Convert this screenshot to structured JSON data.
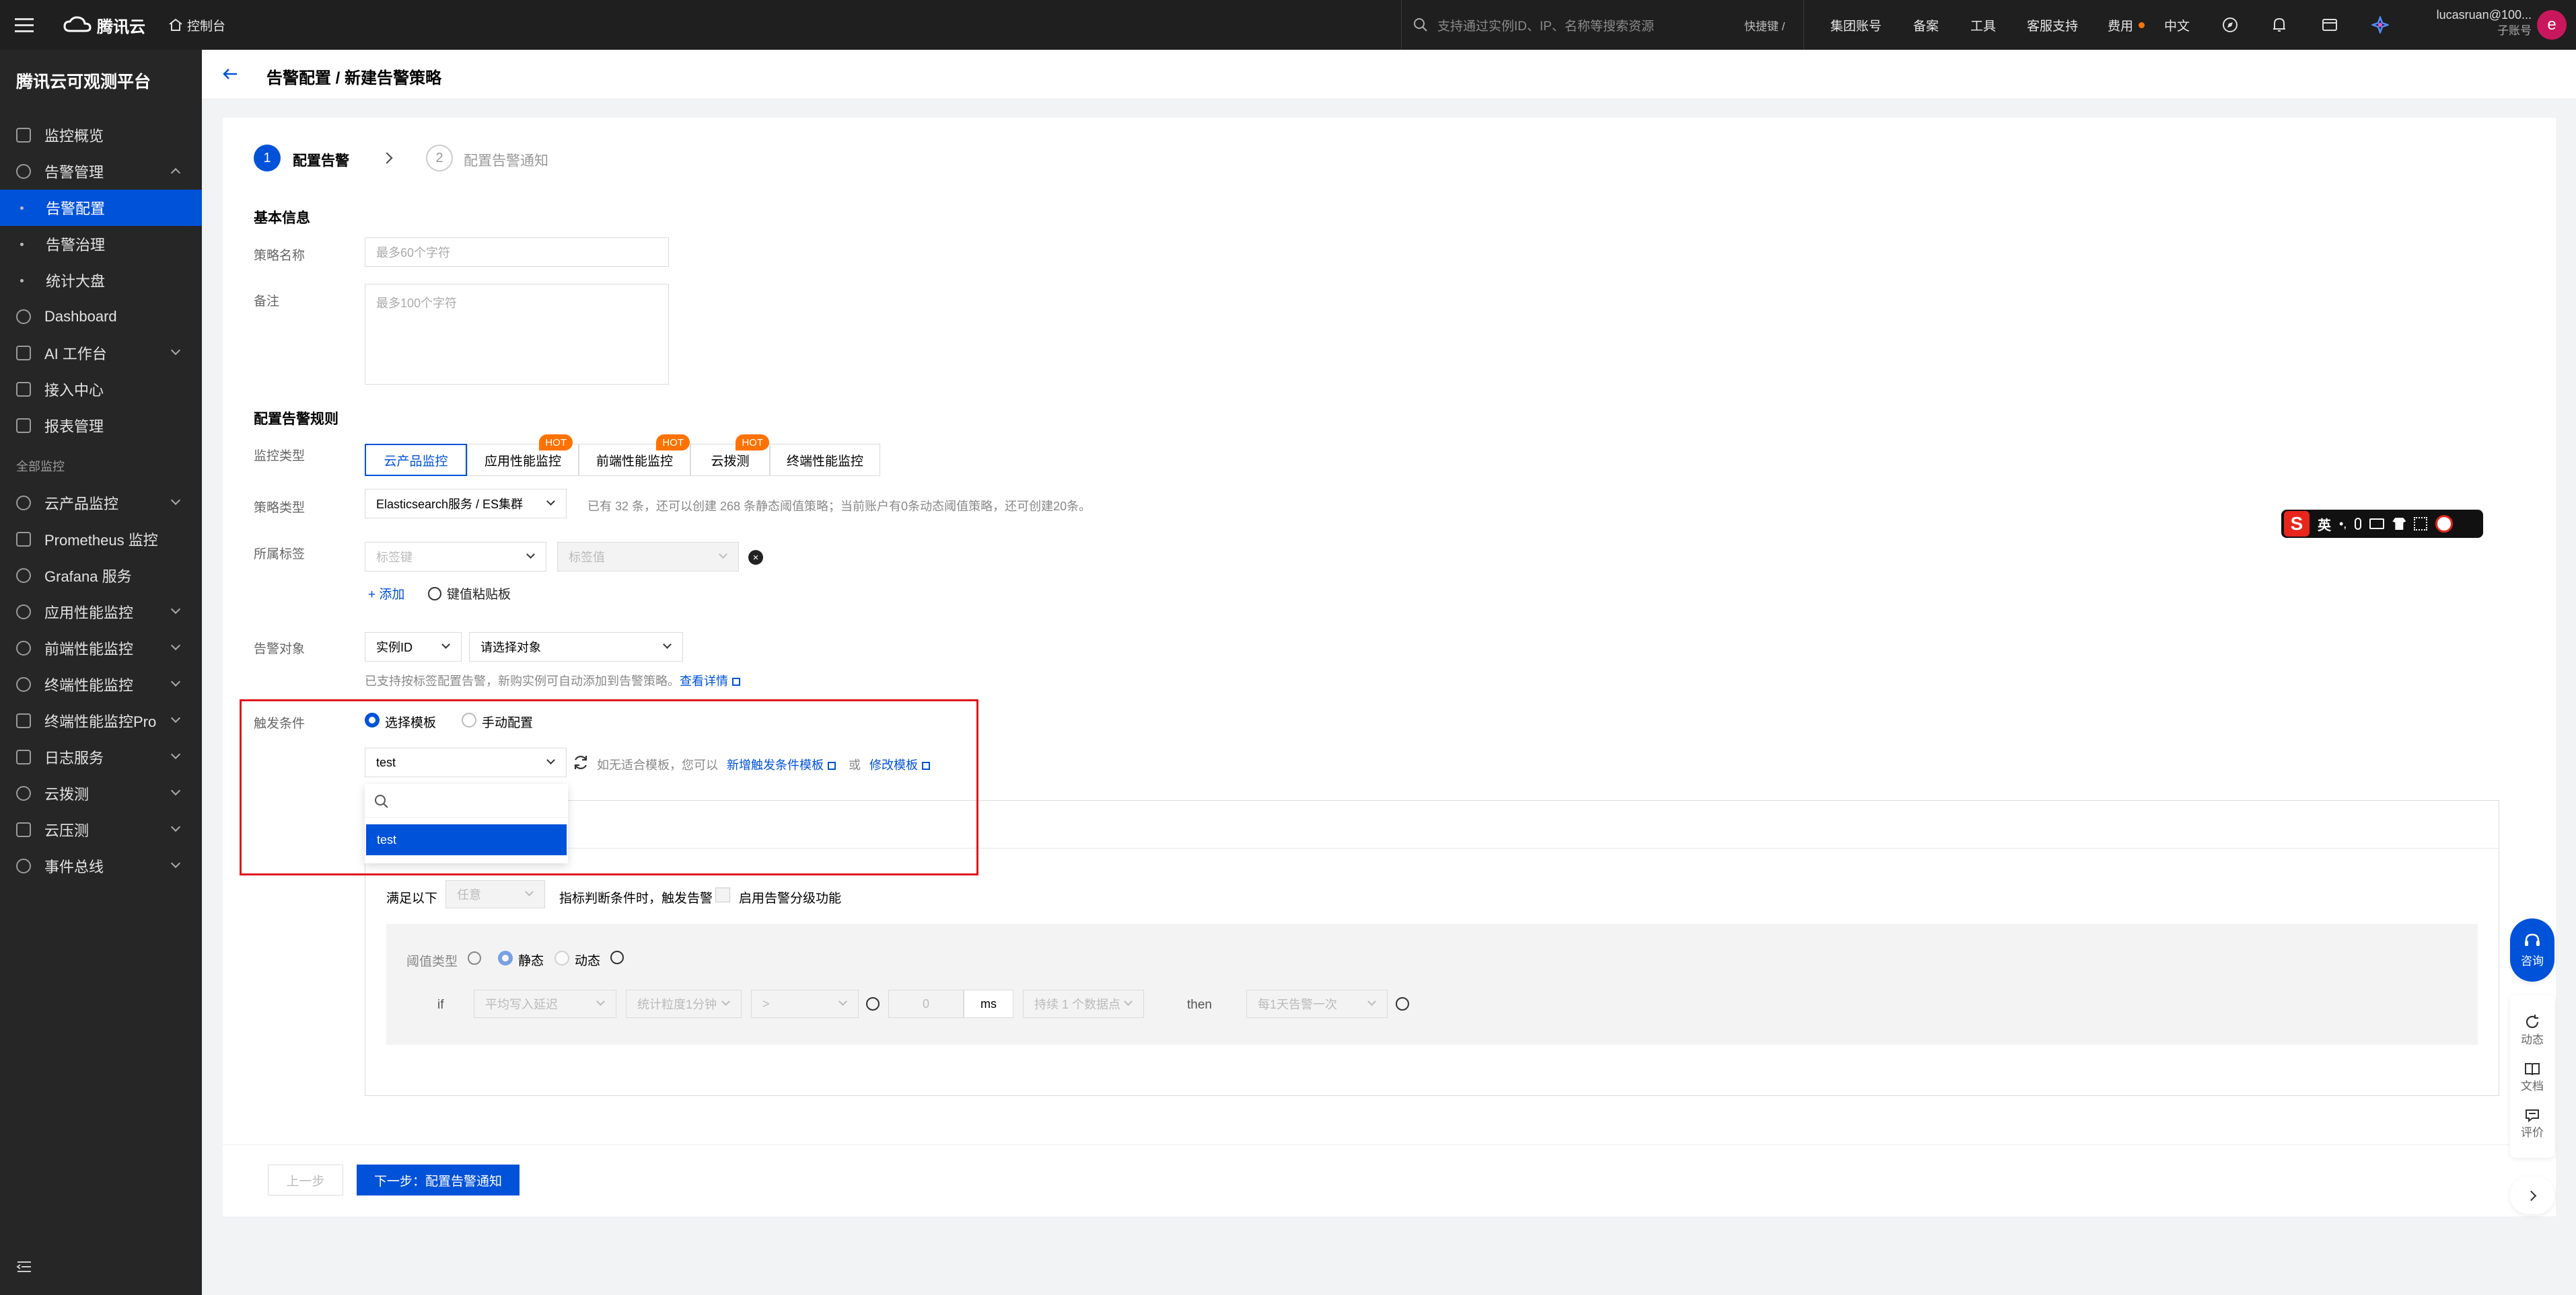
{
  "topbar": {
    "brand": "腾讯云",
    "console": "控制台",
    "search_placeholder": "支持通过实例ID、IP、名称等搜索资源",
    "shortcut": "快捷键 /",
    "links": [
      "集团账号",
      "备案",
      "工具",
      "客服支持",
      "费用",
      "中文"
    ],
    "user_name": "lucasruan@100...",
    "user_role": "子账号",
    "avatar_letter": "e"
  },
  "sidebar": {
    "title": "腾讯云可观测平台",
    "section_label": "全部监控",
    "items": [
      "监控概览",
      "告警管理",
      "告警配置",
      "告警治理",
      "统计大盘",
      "Dashboard",
      "AI 工作台",
      "接入中心",
      "报表管理",
      "云产品监控",
      "Prometheus 监控",
      "Grafana 服务",
      "应用性能监控",
      "前端性能监控",
      "终端性能监控",
      "终端性能监控Pro",
      "日志服务",
      "云拨测",
      "云压测",
      "事件总线"
    ]
  },
  "header": {
    "title": "告警配置 / 新建告警策略"
  },
  "steps": [
    {
      "num": "1",
      "label": "配置告警"
    },
    {
      "num": "2",
      "label": "配置告警通知"
    }
  ],
  "basic": {
    "section": "基本信息",
    "name_label": "策略名称",
    "name_placeholder": "最多60个字符",
    "remark_label": "备注",
    "remark_placeholder": "最多100个字符"
  },
  "rules": {
    "section": "配置告警规则",
    "monitor_type_label": "监控类型",
    "monitor_types": [
      "云产品监控",
      "应用性能监控",
      "前端性能监控",
      "云拨测",
      "终端性能监控"
    ],
    "hot_badge": "HOT",
    "policy_type_label": "策略类型",
    "policy_type_value": "Elasticsearch服务 / ES集群",
    "policy_note": "已有 32 条，还可以创建 268 条静态阈值策略；当前账户有0条动态阈值策略，还可创建20条。",
    "tag_label": "所属标签",
    "tag_key_placeholder": "标签键",
    "tag_value_placeholder": "标签值",
    "add_label": "添加",
    "paste_label": "键值粘贴板",
    "target_label": "告警对象",
    "target_type": "实例ID",
    "target_placeholder": "请选择对象",
    "target_note": "已支持按标签配置告警，新购实例可自动添加到告警策略。",
    "target_link": "查看详情",
    "trigger_label": "触发条件",
    "trigger_opt1": "选择模板",
    "trigger_opt2": "手动配置",
    "template_value": "test",
    "template_hint": "如无适合模板，您可以",
    "template_new_link": "新增触发条件模板",
    "template_or": "或",
    "template_edit_link": "修改模板",
    "dropdown_option": "test",
    "satisfy_label": "满足以下",
    "satisfy_value": "任意",
    "satisfy_suffix": "指标判断条件时，触发告警",
    "level_label": "启用告警分级功能",
    "threshold_label": "阈值类型",
    "threshold_static": "静态",
    "threshold_dynamic": "动态",
    "if_label": "if",
    "metric_value": "平均写入延迟",
    "period_value": "统计粒度1分钟",
    "operator_value": ">",
    "threshold_value": "0",
    "unit": "ms",
    "duration_value": "持续 1 个数据点",
    "then_label": "then",
    "repeat_value": "每1天告警一次"
  },
  "footer": {
    "prev": "上一步",
    "next": "下一步：配置告警通知"
  },
  "float": {
    "consult": "咨询",
    "dynamic": "动态",
    "docs": "文档",
    "review": "评价"
  },
  "ime": {
    "lang": "英"
  },
  "colors": {
    "primary": "#0052d9",
    "hot": "#ff7200",
    "highlight_box": "#e0161d"
  }
}
